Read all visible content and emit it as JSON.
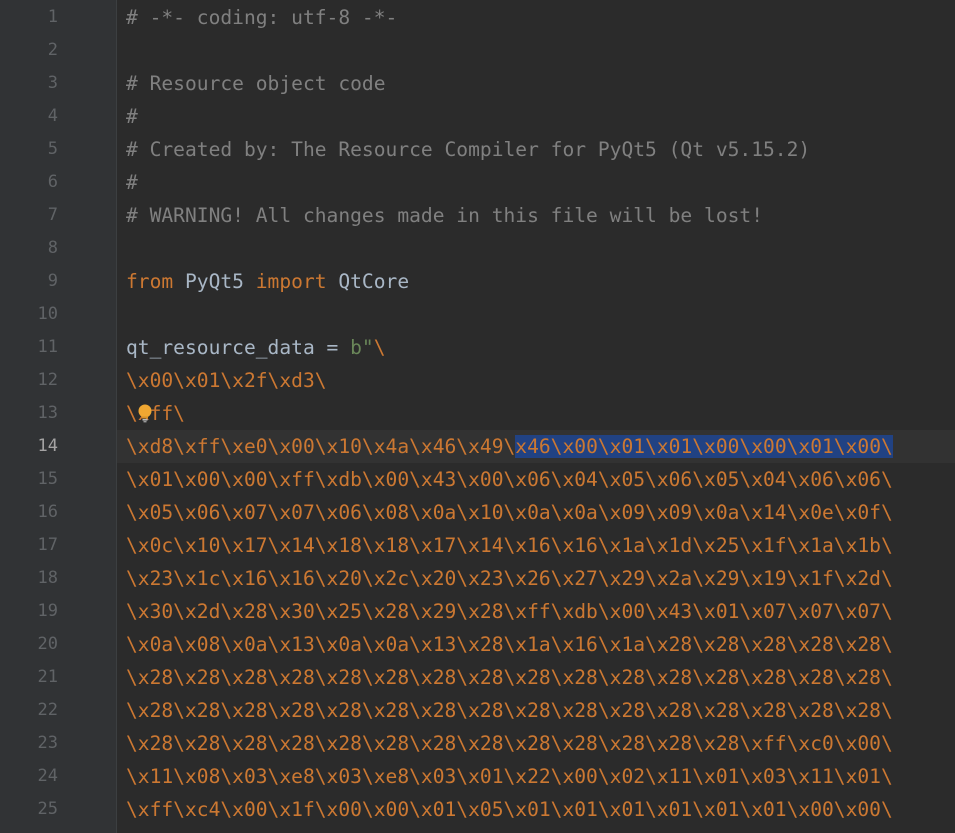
{
  "editor": {
    "current_line": "14",
    "lines": [
      {
        "num": "1",
        "text": "# -*- coding: utf-8 -*-"
      },
      {
        "num": "2",
        "text": ""
      },
      {
        "num": "3",
        "text": "# Resource object code"
      },
      {
        "num": "4",
        "text": "#"
      },
      {
        "num": "5",
        "text": "# Created by: The Resource Compiler for PyQt5 (Qt v5.15.2)"
      },
      {
        "num": "6",
        "text": "#"
      },
      {
        "num": "7",
        "text": "# WARNING! All changes made in this file will be lost!"
      },
      {
        "num": "8",
        "text": ""
      },
      {
        "num": "9",
        "kw1": "from",
        "mod": "PyQt5",
        "kw2": "import",
        "cls": "QtCore"
      },
      {
        "num": "10",
        "text": ""
      },
      {
        "num": "11",
        "var": "qt_resource_data = ",
        "str_prefix": "b\"",
        "esc": "\\"
      },
      {
        "num": "12",
        "text": "\\x00\\x01\\x2f\\xd3\\"
      },
      {
        "num": "13",
        "text": "\\xff\\"
      },
      {
        "num": "14",
        "before_sel": "\\xd8\\xff\\xe0\\x00\\x10\\x4a\\x46\\x49\\",
        "selected": "x46\\x00\\x01\\x01\\x00\\x00\\x01\\x00\\"
      },
      {
        "num": "15",
        "text": "\\x01\\x00\\x00\\xff\\xdb\\x00\\x43\\x00\\x06\\x04\\x05\\x06\\x05\\x04\\x06\\x06\\"
      },
      {
        "num": "16",
        "text": "\\x05\\x06\\x07\\x07\\x06\\x08\\x0a\\x10\\x0a\\x0a\\x09\\x09\\x0a\\x14\\x0e\\x0f\\"
      },
      {
        "num": "17",
        "text": "\\x0c\\x10\\x17\\x14\\x18\\x18\\x17\\x14\\x16\\x16\\x1a\\x1d\\x25\\x1f\\x1a\\x1b\\"
      },
      {
        "num": "18",
        "text": "\\x23\\x1c\\x16\\x16\\x20\\x2c\\x20\\x23\\x26\\x27\\x29\\x2a\\x29\\x19\\x1f\\x2d\\"
      },
      {
        "num": "19",
        "text": "\\x30\\x2d\\x28\\x30\\x25\\x28\\x29\\x28\\xff\\xdb\\x00\\x43\\x01\\x07\\x07\\x07\\"
      },
      {
        "num": "20",
        "text": "\\x0a\\x08\\x0a\\x13\\x0a\\x0a\\x13\\x28\\x1a\\x16\\x1a\\x28\\x28\\x28\\x28\\x28\\"
      },
      {
        "num": "21",
        "text": "\\x28\\x28\\x28\\x28\\x28\\x28\\x28\\x28\\x28\\x28\\x28\\x28\\x28\\x28\\x28\\x28\\"
      },
      {
        "num": "22",
        "text": "\\x28\\x28\\x28\\x28\\x28\\x28\\x28\\x28\\x28\\x28\\x28\\x28\\x28\\x28\\x28\\x28\\"
      },
      {
        "num": "23",
        "text": "\\x28\\x28\\x28\\x28\\x28\\x28\\x28\\x28\\x28\\x28\\x28\\x28\\x28\\xff\\xc0\\x00\\"
      },
      {
        "num": "24",
        "text": "\\x11\\x08\\x03\\xe8\\x03\\xe8\\x03\\x01\\x22\\x00\\x02\\x11\\x01\\x03\\x11\\x01\\"
      },
      {
        "num": "25",
        "text": "\\xff\\xc4\\x00\\x1f\\x00\\x00\\x01\\x05\\x01\\x01\\x01\\x01\\x01\\x01\\x00\\x00\\"
      }
    ],
    "colors": {
      "background": "#2b2b2b",
      "gutter": "#313335",
      "comment": "#808080",
      "keyword": "#cc7832",
      "identifier": "#a9b7c6",
      "string": "#6a8759",
      "selection": "#214283",
      "line_number": "#606366"
    },
    "icons": {
      "intention": "lightbulb-icon"
    }
  }
}
